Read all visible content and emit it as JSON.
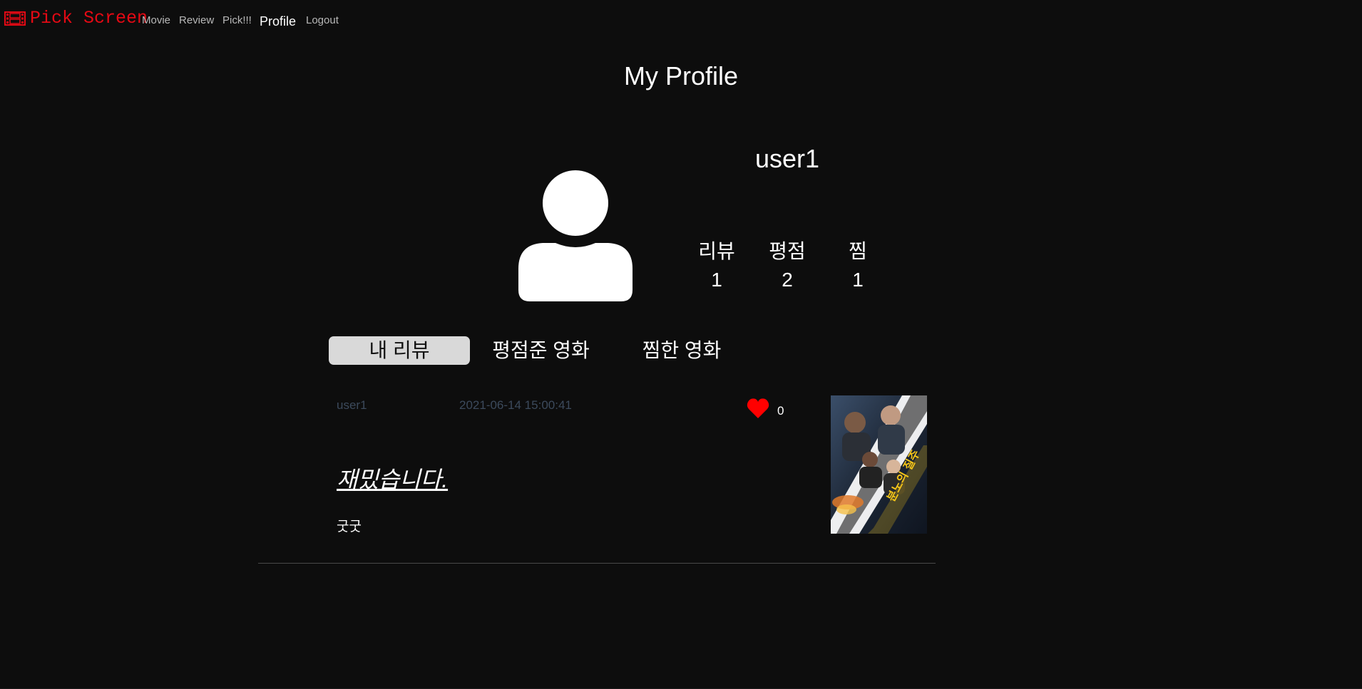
{
  "nav": {
    "brand": "Pick Screen",
    "links": [
      {
        "label": "Movie"
      },
      {
        "label": "Review"
      },
      {
        "label": "Pick!!!"
      },
      {
        "label": "Profile"
      },
      {
        "label": "Logout"
      }
    ],
    "active": "Profile"
  },
  "page": {
    "title": "My Profile"
  },
  "profile": {
    "username": "user1",
    "stats": [
      {
        "label": "리뷰",
        "value": "1"
      },
      {
        "label": "평점",
        "value": "2"
      },
      {
        "label": "찜",
        "value": "1"
      }
    ]
  },
  "tabs": [
    {
      "label": "내 리뷰",
      "active": true
    },
    {
      "label": "평점준 영화",
      "active": false
    },
    {
      "label": "찜한 영화",
      "active": false
    }
  ],
  "reviews": [
    {
      "author": "user1",
      "date": "2021-06-14 15:00:41",
      "likes": "0",
      "title": "재밌습니다.",
      "body": "굿굿",
      "poster_text": "분노의 질주"
    }
  ],
  "colors": {
    "brand": "#e50914",
    "background": "#0d0d0d",
    "heart": "#ff0000",
    "tab_active_bg": "#d9d9d9",
    "meta_text": "#3c4a5c"
  },
  "icons": {
    "brand": "film-icon",
    "avatar": "user-silhouette-icon",
    "like": "heart-icon"
  }
}
